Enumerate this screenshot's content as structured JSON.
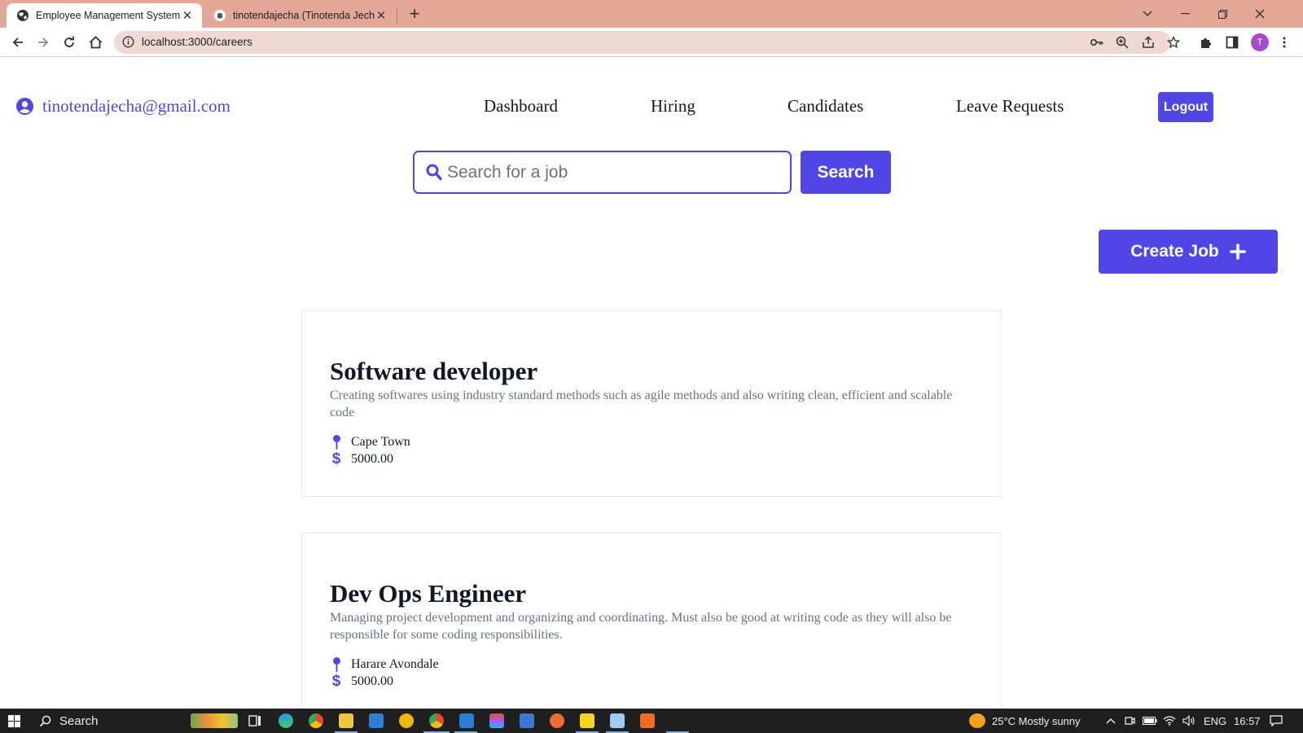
{
  "browser": {
    "tabs": [
      {
        "title": "Employee Management System",
        "active": true,
        "icon": "globe-icon"
      },
      {
        "title": "tinotendajecha (Tinotenda Jecha)",
        "active": false,
        "icon": "github-icon"
      }
    ],
    "url": "localhost:3000/careers",
    "profile_initial": "T"
  },
  "header": {
    "user_email": "tinotendajecha@gmail.com",
    "nav": {
      "dashboard": "Dashboard",
      "hiring": "Hiring",
      "candidates": "Candidates",
      "leave_requests": "Leave Requests"
    },
    "logout_label": "Logout"
  },
  "search": {
    "placeholder": "Search for a job",
    "value": "",
    "button_label": "Search"
  },
  "create_job_label": "Create Job",
  "jobs": [
    {
      "title": "Software developer",
      "description": "Creating softwares using industry standard methods such as agile methods and also writing clean, efficient and scalable code",
      "location": "Cape Town",
      "salary": "5000.00"
    },
    {
      "title": "Dev Ops Engineer",
      "description": "Managing project development and organizing and coordinating. Must also be good at writing code as they will also be responsible for some coding responsibilities.",
      "location": "Harare Avondale",
      "salary": "5000.00"
    }
  ],
  "taskbar": {
    "search_label": "Search",
    "weather": "25°C  Mostly sunny",
    "language": "ENG",
    "time": "16:57"
  },
  "colors": {
    "accent": "#4f46e5",
    "tab_strip": "#e3a898",
    "omnibox": "#f0d8d3",
    "taskbar": "#1f1f1f"
  }
}
